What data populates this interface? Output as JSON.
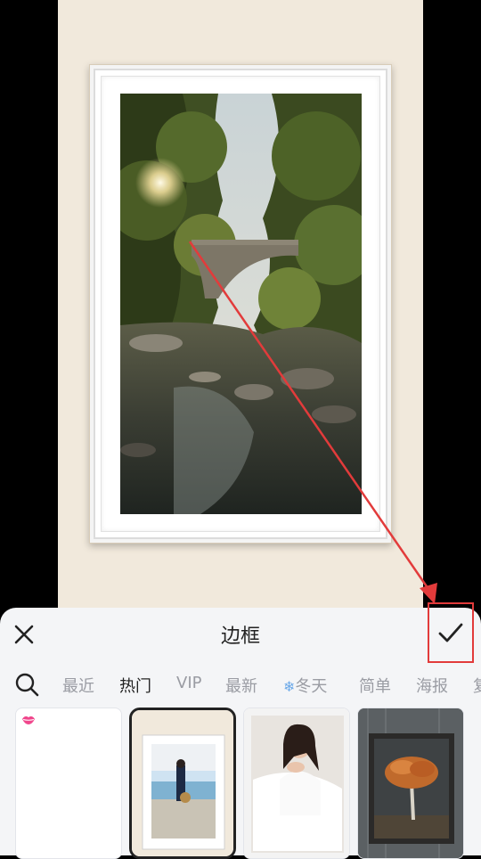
{
  "sheet": {
    "title": "边框",
    "close_icon": "close-icon",
    "confirm_icon": "check-icon"
  },
  "tabs": {
    "search_icon": "search-icon",
    "items": [
      {
        "label": "最近",
        "active": false
      },
      {
        "label": "热门",
        "active": true
      },
      {
        "label": "VIP",
        "active": false
      },
      {
        "label": "最新",
        "active": false
      },
      {
        "label": "冬天",
        "active": false,
        "icon": "snowflake-icon"
      },
      {
        "label": "简单",
        "active": false
      },
      {
        "label": "海报",
        "active": false
      },
      {
        "label": "复",
        "active": false
      }
    ]
  },
  "thumbnails": [
    {
      "name": "ocean-poster-frame",
      "selected": false,
      "badge": "lips-icon"
    },
    {
      "name": "white-frame-woman",
      "selected": true
    },
    {
      "name": "portrait-woman-frame",
      "selected": false
    },
    {
      "name": "dark-frame-tree",
      "selected": false
    }
  ],
  "colors": {
    "canvas_bg": "#f1e9dc",
    "sheet_bg": "#f4f5f7",
    "annotation_red": "#e23b3b",
    "active_tab": "#222222",
    "inactive_tab": "#9a9ca3"
  }
}
